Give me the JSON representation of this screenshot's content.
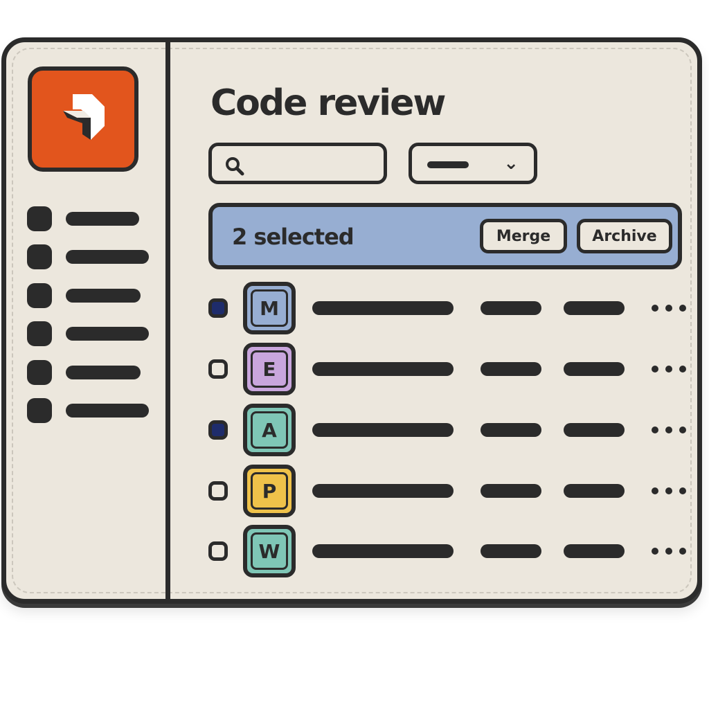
{
  "header": {
    "title": "Code review"
  },
  "search": {
    "icon": "search-icon"
  },
  "filter": {
    "icon": "chevron-down-icon"
  },
  "selection": {
    "label": "2 selected",
    "merge_label": "Merge",
    "archive_label": "Archive",
    "color": "#97aed2"
  },
  "sidebar": {
    "logo_color": "#e2551d",
    "item_count": 6
  },
  "rows": [
    {
      "initial": "M",
      "checked": true,
      "color": "#97aed2"
    },
    {
      "initial": "E",
      "checked": false,
      "color": "#c9a6dd"
    },
    {
      "initial": "A",
      "checked": true,
      "color": "#7fc6b6"
    },
    {
      "initial": "P",
      "checked": false,
      "color": "#efc24a"
    },
    {
      "initial": "W",
      "checked": false,
      "color": "#7fc6b6"
    }
  ]
}
